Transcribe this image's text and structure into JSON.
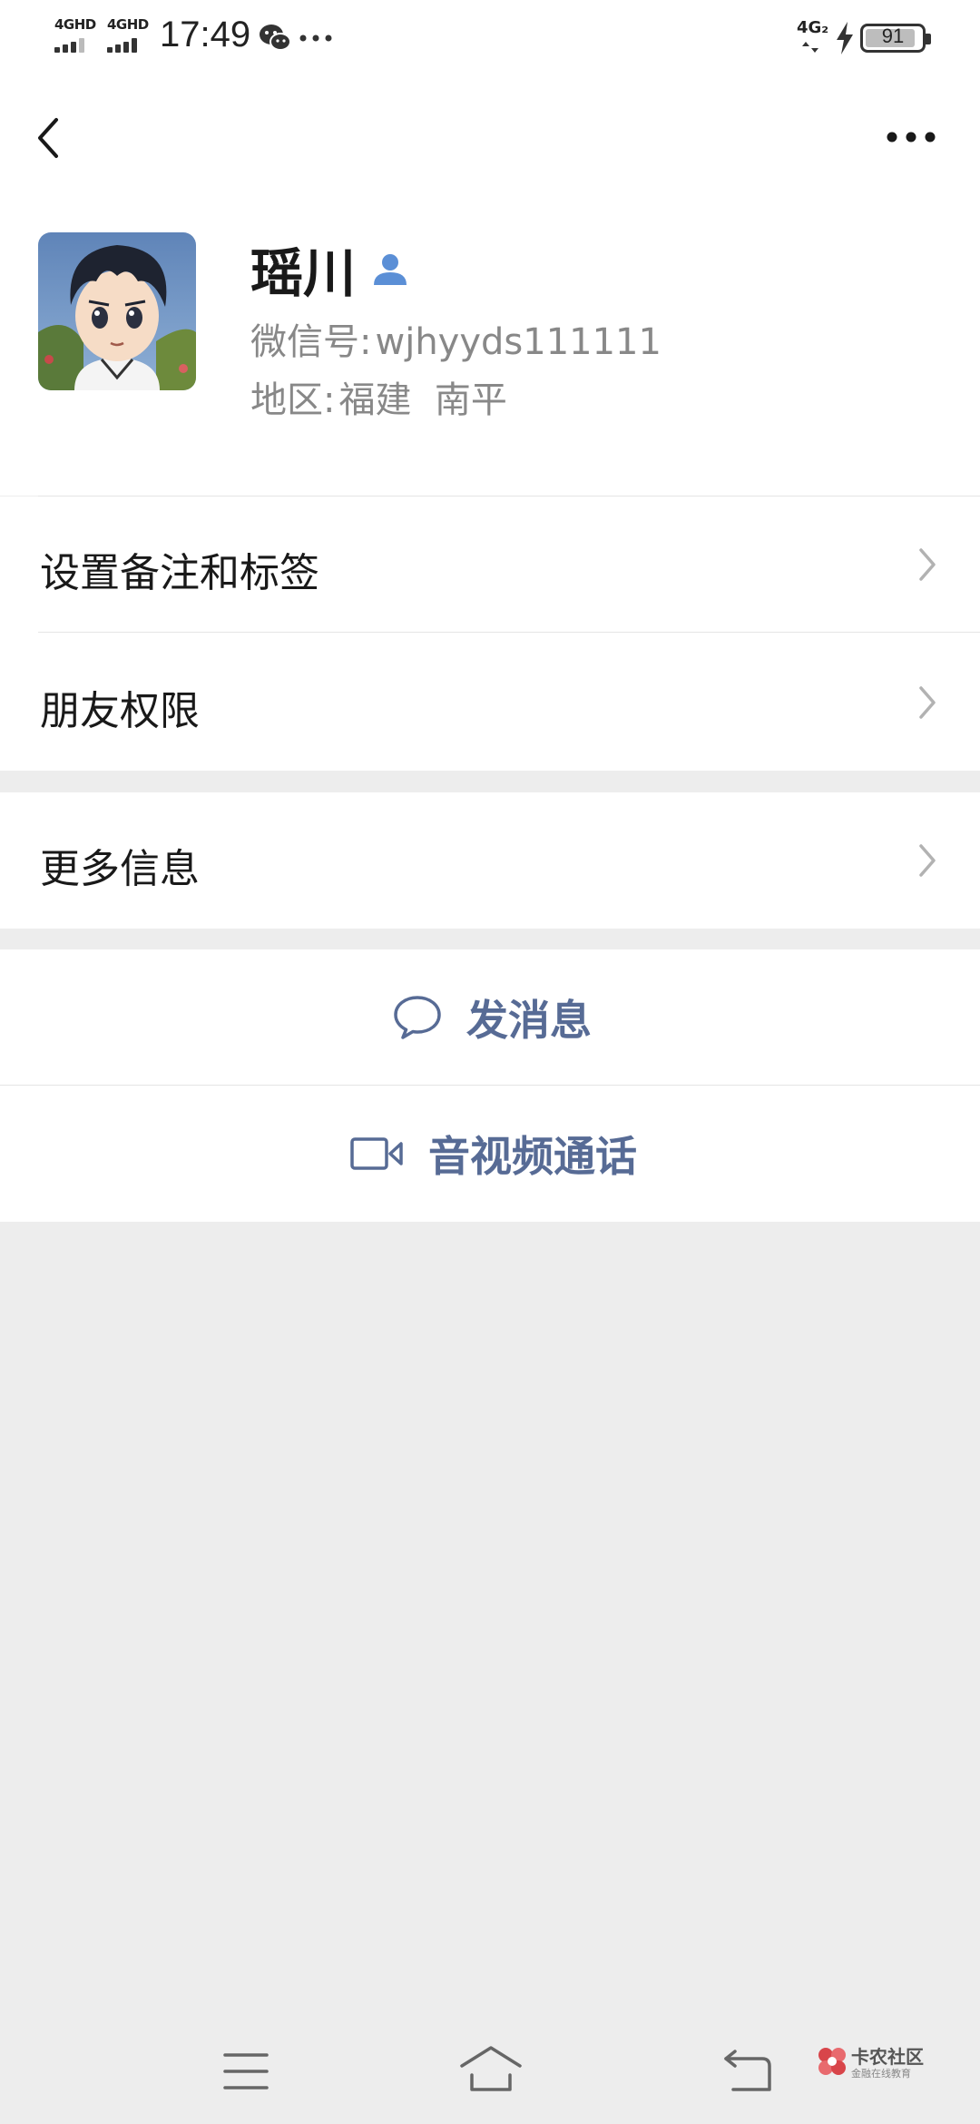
{
  "status_bar": {
    "sim1_label": "4GHD",
    "sim2_label": "4GHD",
    "time": "17:49",
    "network_right": "4G₂",
    "battery_level": "91",
    "battery_fraction": 0.91
  },
  "profile": {
    "name": "瑶川",
    "wxid_label": "微信号:",
    "wxid_value": "wjhyyds111111",
    "region_label": "地区:",
    "region_value": "福建  南平"
  },
  "menu": {
    "remark_tags": "设置备注和标签",
    "friend_permissions": "朋友权限",
    "more_info": "更多信息"
  },
  "actions": {
    "send_message": "发消息",
    "video_call": "音视频通话"
  },
  "watermark": {
    "title": "卡农社区",
    "subtitle": "金融在线教育"
  },
  "colors": {
    "link_blue": "#576b95",
    "background": "#ededed",
    "contact_icon": "#5b8fd6"
  },
  "icons": [
    "back-icon",
    "more-icon",
    "contact-icon",
    "chevron-icon",
    "chat-bubble-icon",
    "video-camera-icon",
    "menu-icon",
    "home-icon",
    "return-icon"
  ]
}
